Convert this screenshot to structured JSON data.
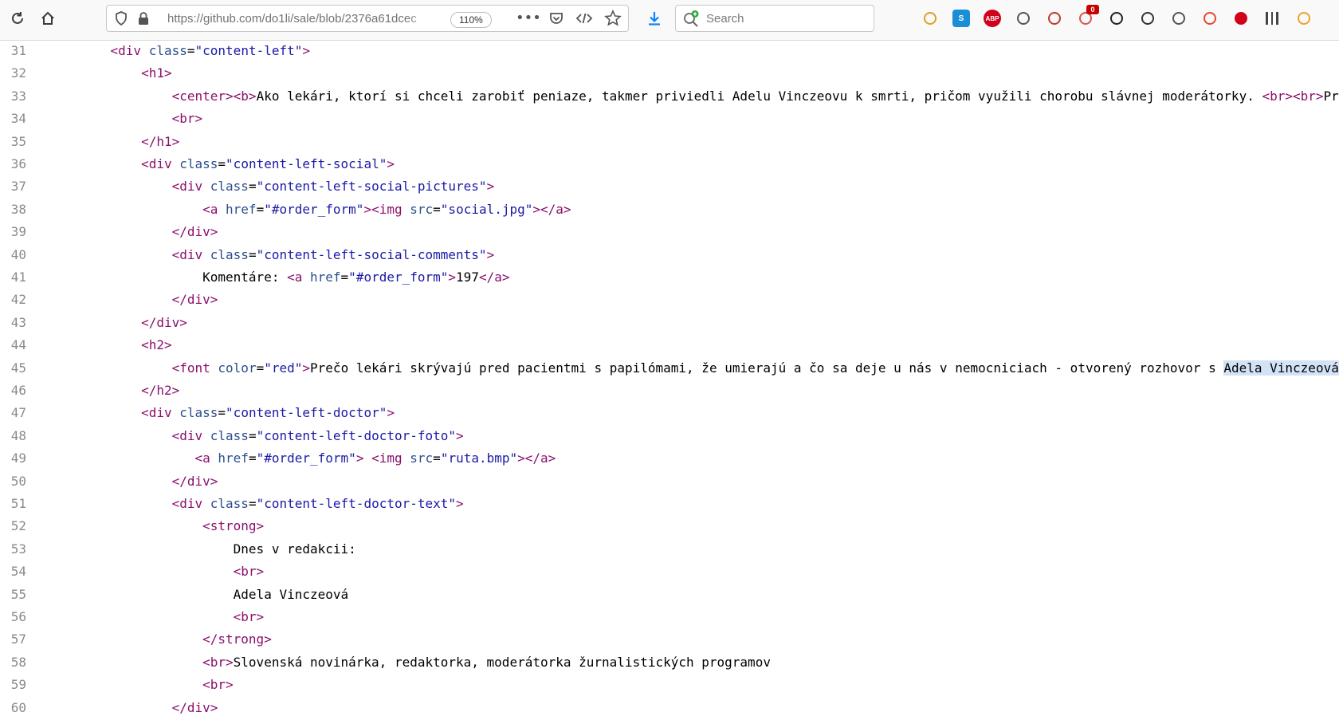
{
  "toolbar": {
    "url": "https://github.com/do1li/sale/blob/2376a61dcec",
    "zoom": "110%",
    "search_placeholder": "Search",
    "extensions": [
      {
        "name": "shoe-extension-icon",
        "color": "#e0a020"
      },
      {
        "name": "skype-icon",
        "color": "#1a8fd6",
        "label": "S"
      },
      {
        "name": "adblock-plus-icon",
        "color": "#d0021b",
        "label": "ABP"
      },
      {
        "name": "reader-view-icon",
        "color": "#555555"
      },
      {
        "name": "multicolor-balls-icon",
        "color": "#c0392b"
      },
      {
        "name": "privacy-badger-icon",
        "color": "#d9534f",
        "badge": "0"
      },
      {
        "name": "paw-icon",
        "color": "#222222"
      },
      {
        "name": "bear-icon",
        "color": "#333333"
      },
      {
        "name": "ghost-icon",
        "color": "#555555"
      },
      {
        "name": "chrome-style-icon",
        "color": "#e5492d"
      },
      {
        "name": "red-dot-icon",
        "color": "#d0021b"
      },
      {
        "name": "barcode-icon",
        "color": "#444444"
      },
      {
        "name": "gift-icon",
        "color": "#f0a030"
      }
    ]
  },
  "source_lines": [
    {
      "n": "31",
      "html": "    <span class=\"tag\">&lt;div</span> <span class=\"attr\">class</span>=<span class=\"val\">\"content-left\"</span><span class=\"tag\">&gt;</span>"
    },
    {
      "n": "32",
      "html": "        <span class=\"tag\">&lt;h1&gt;</span>"
    },
    {
      "n": "33",
      "html": "            <span class=\"tag\">&lt;center&gt;&lt;b&gt;</span>Ako lekári, ktorí si chceli zarobiť peniaze, takmer priviedli Adelu Vinczeovu k smrti, pričom využili chorobu slávnej moderátorky. <span class=\"tag\">&lt;br&gt;&lt;br&gt;</span>Prečo ľudi"
    },
    {
      "n": "34",
      "html": "            <span class=\"tag\">&lt;br&gt;</span>"
    },
    {
      "n": "35",
      "html": "        <span class=\"tag\">&lt;/h1&gt;</span>"
    },
    {
      "n": "36",
      "html": "        <span class=\"tag\">&lt;div</span> <span class=\"attr\">class</span>=<span class=\"val\">\"content-left-social\"</span><span class=\"tag\">&gt;</span>"
    },
    {
      "n": "37",
      "html": "            <span class=\"tag\">&lt;div</span> <span class=\"attr\">class</span>=<span class=\"val\">\"content-left-social-pictures\"</span><span class=\"tag\">&gt;</span>"
    },
    {
      "n": "38",
      "html": "                <span class=\"tag\">&lt;a</span> <span class=\"attr\">href</span>=<span class=\"val\">\"#order_form\"</span><span class=\"tag\">&gt;&lt;img</span> <span class=\"attr\">src</span>=<span class=\"val\">\"social.jpg\"</span><span class=\"tag\">&gt;&lt;/a&gt;</span>"
    },
    {
      "n": "39",
      "html": "            <span class=\"tag\">&lt;/div&gt;</span>"
    },
    {
      "n": "40",
      "html": "            <span class=\"tag\">&lt;div</span> <span class=\"attr\">class</span>=<span class=\"val\">\"content-left-social-comments\"</span><span class=\"tag\">&gt;</span>"
    },
    {
      "n": "41",
      "html": "                Komentáre: <span class=\"tag\">&lt;a</span> <span class=\"attr\">href</span>=<span class=\"val\">\"#order_form\"</span><span class=\"tag\">&gt;</span>197<span class=\"tag\">&lt;/a&gt;</span>"
    },
    {
      "n": "42",
      "html": "            <span class=\"tag\">&lt;/div&gt;</span>"
    },
    {
      "n": "43",
      "html": "        <span class=\"tag\">&lt;/div&gt;</span>"
    },
    {
      "n": "44",
      "html": "        <span class=\"tag\">&lt;h2&gt;</span>"
    },
    {
      "n": "45",
      "html": "            <span class=\"tag\">&lt;font</span> <span class=\"attr\">color</span>=<span class=\"val\">\"red\"</span><span class=\"tag\">&gt;</span>Prečo lekári skrývajú pred pacientmi s papilómami, že umierajú a čo sa deje u nás v nemocniciach - otvorený rozhovor s <span class=\"hl\">Adela Vinczeová</span><span class=\"tag\">&lt;/font&gt;</span>"
    },
    {
      "n": "46",
      "html": "        <span class=\"tag\">&lt;/h2&gt;</span>"
    },
    {
      "n": "47",
      "html": "        <span class=\"tag\">&lt;div</span> <span class=\"attr\">class</span>=<span class=\"val\">\"content-left-doctor\"</span><span class=\"tag\">&gt;</span>"
    },
    {
      "n": "48",
      "html": "            <span class=\"tag\">&lt;div</span> <span class=\"attr\">class</span>=<span class=\"val\">\"content-left-doctor-foto\"</span><span class=\"tag\">&gt;</span>"
    },
    {
      "n": "49",
      "html": "               <span class=\"tag\">&lt;a</span> <span class=\"attr\">href</span>=<span class=\"val\">\"#order_form\"</span><span class=\"tag\">&gt;</span> <span class=\"tag\">&lt;img</span> <span class=\"attr\">src</span>=<span class=\"val\">\"ruta.bmp\"</span><span class=\"tag\">&gt;&lt;/a&gt;</span>"
    },
    {
      "n": "50",
      "html": "            <span class=\"tag\">&lt;/div&gt;</span>"
    },
    {
      "n": "51",
      "html": "            <span class=\"tag\">&lt;div</span> <span class=\"attr\">class</span>=<span class=\"val\">\"content-left-doctor-text\"</span><span class=\"tag\">&gt;</span>"
    },
    {
      "n": "52",
      "html": "                <span class=\"tag\">&lt;strong&gt;</span>"
    },
    {
      "n": "53",
      "html": "                    Dnes v redakcii:"
    },
    {
      "n": "54",
      "html": "                    <span class=\"tag\">&lt;br&gt;</span>"
    },
    {
      "n": "55",
      "html": "                    Adela Vinczeová"
    },
    {
      "n": "56",
      "html": "                    <span class=\"tag\">&lt;br&gt;</span>"
    },
    {
      "n": "57",
      "html": "                <span class=\"tag\">&lt;/strong&gt;</span>"
    },
    {
      "n": "58",
      "html": "                <span class=\"tag\">&lt;br&gt;</span>Slovenská novinárka, redaktorka, moderátorka žurnalistických programov"
    },
    {
      "n": "59",
      "html": "                <span class=\"tag\">&lt;br&gt;</span>"
    },
    {
      "n": "60",
      "html": "            <span class=\"tag\">&lt;/div&gt;</span>"
    }
  ]
}
